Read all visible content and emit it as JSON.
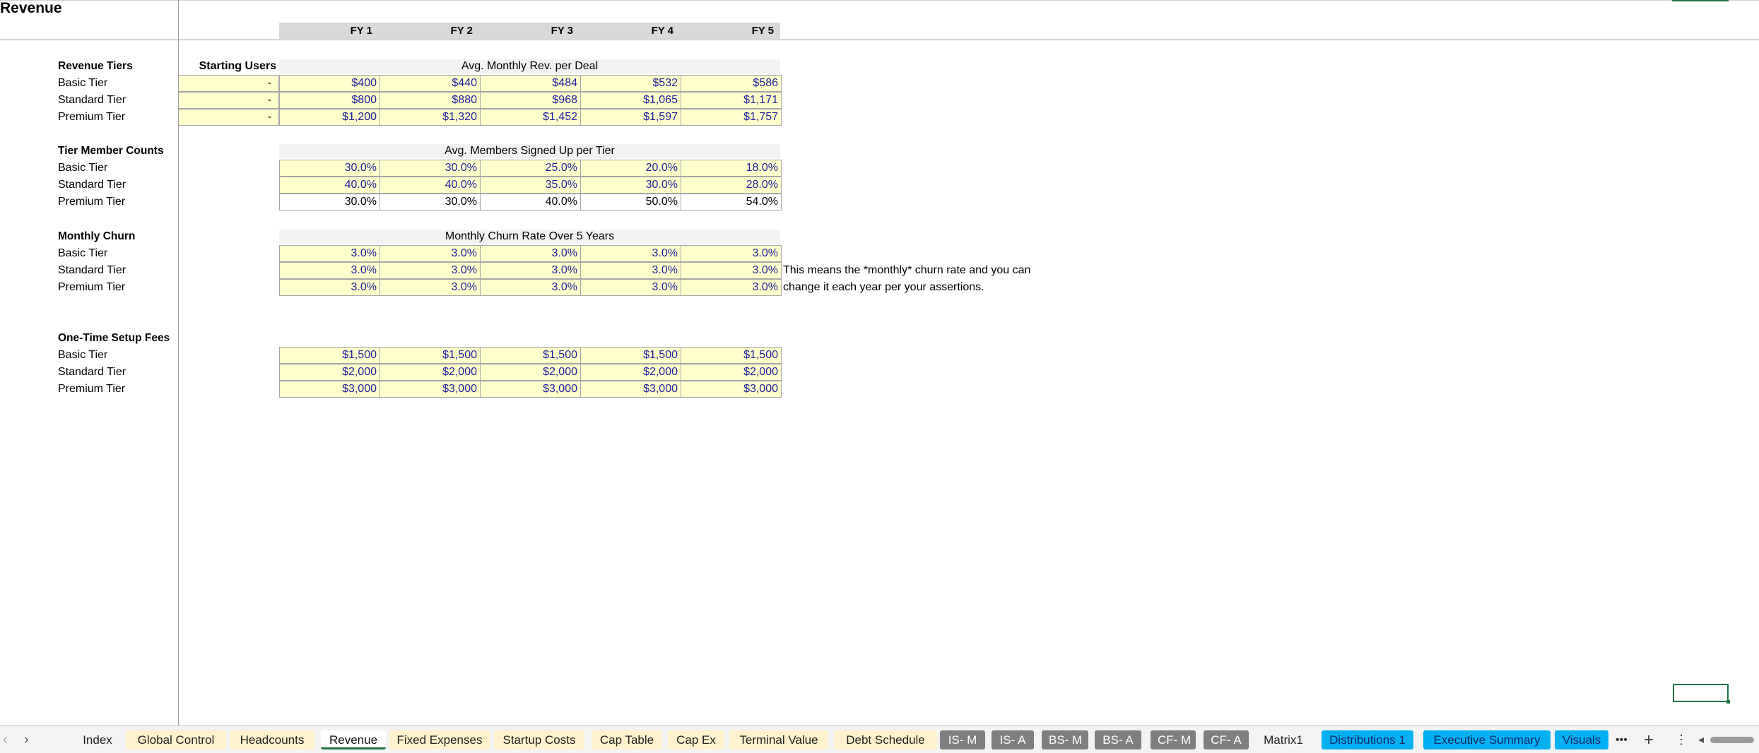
{
  "sheet_title": "Revenue",
  "fiscal_years": [
    "FY 1",
    "FY 2",
    "FY 3",
    "FY 4",
    "FY 5"
  ],
  "revenue_tiers": {
    "label": "Revenue Tiers",
    "starting_users_header": "Starting Users",
    "band_header": "Avg. Monthly Rev. per Deal",
    "rows": [
      {
        "label": "Basic Tier",
        "starting": "-",
        "values": [
          "$400",
          "$440",
          "$484",
          "$532",
          "$586"
        ]
      },
      {
        "label": "Standard Tier",
        "starting": "-",
        "values": [
          "$800",
          "$880",
          "$968",
          "$1,065",
          "$1,171"
        ]
      },
      {
        "label": "Premium Tier",
        "starting": "-",
        "values": [
          "$1,200",
          "$1,320",
          "$1,452",
          "$1,597",
          "$1,757"
        ]
      }
    ]
  },
  "member_counts": {
    "label": "Tier Member Counts",
    "band_header": "Avg. Members Signed Up per Tier",
    "rows": [
      {
        "label": "Basic Tier",
        "values": [
          "30.0%",
          "30.0%",
          "25.0%",
          "20.0%",
          "18.0%"
        ]
      },
      {
        "label": "Standard Tier",
        "values": [
          "40.0%",
          "40.0%",
          "35.0%",
          "30.0%",
          "28.0%"
        ]
      },
      {
        "label": "Premium Tier",
        "values": [
          "30.0%",
          "30.0%",
          "40.0%",
          "50.0%",
          "54.0%"
        ]
      }
    ]
  },
  "monthly_churn": {
    "label": "Monthly Churn",
    "band_header": "Monthly Churn Rate Over 5 Years",
    "rows": [
      {
        "label": "Basic Tier",
        "values": [
          "3.0%",
          "3.0%",
          "3.0%",
          "3.0%",
          "3.0%"
        ]
      },
      {
        "label": "Standard Tier",
        "values": [
          "3.0%",
          "3.0%",
          "3.0%",
          "3.0%",
          "3.0%"
        ]
      },
      {
        "label": "Premium Tier",
        "values": [
          "3.0%",
          "3.0%",
          "3.0%",
          "3.0%",
          "3.0%"
        ]
      }
    ],
    "note_line1": "This means the *monthly* churn rate and you can",
    "note_line2": "change it each year per your assertions."
  },
  "setup_fees": {
    "label": "One-Time Setup Fees",
    "rows": [
      {
        "label": "Basic Tier",
        "values": [
          "$1,500",
          "$1,500",
          "$1,500",
          "$1,500",
          "$1,500"
        ]
      },
      {
        "label": "Standard Tier",
        "values": [
          "$2,000",
          "$2,000",
          "$2,000",
          "$2,000",
          "$2,000"
        ]
      },
      {
        "label": "Premium Tier",
        "values": [
          "$3,000",
          "$3,000",
          "$3,000",
          "$3,000",
          "$3,000"
        ]
      }
    ]
  },
  "tabs": [
    {
      "label": "Index",
      "style": "plain"
    },
    {
      "label": "Global Control",
      "style": "yellow"
    },
    {
      "label": "Headcounts",
      "style": "yellow"
    },
    {
      "label": "Revenue",
      "style": "active"
    },
    {
      "label": "Fixed Expenses",
      "style": "yellow"
    },
    {
      "label": "Startup Costs",
      "style": "yellow"
    },
    {
      "label": "Cap Table",
      "style": "yellow"
    },
    {
      "label": "Cap Ex",
      "style": "yellow"
    },
    {
      "label": "Terminal Value",
      "style": "yellow"
    },
    {
      "label": "Debt Schedule",
      "style": "yellow"
    },
    {
      "label": "IS- M",
      "style": "gray"
    },
    {
      "label": "IS- A",
      "style": "gray"
    },
    {
      "label": "BS- M",
      "style": "gray"
    },
    {
      "label": "BS- A",
      "style": "gray"
    },
    {
      "label": "CF- M",
      "style": "gray"
    },
    {
      "label": "CF- A",
      "style": "gray"
    },
    {
      "label": "Matrix1",
      "style": "plain"
    },
    {
      "label": "Distributions 1",
      "style": "blue"
    },
    {
      "label": "Executive Summary",
      "style": "blue"
    },
    {
      "label": "Visuals",
      "style": "blue"
    }
  ],
  "icons": {
    "prev": "chevron-left-icon",
    "next": "chevron-right-icon",
    "more": "more-tabs-icon",
    "add": "add-sheet-icon",
    "options": "vertical-dots-icon"
  },
  "colors": {
    "input_fill": "#ffffcc",
    "input_text": "#1f1f9e",
    "tab_yellow": "#fff2cc",
    "tab_gray": "#7f7f7f",
    "tab_blue": "#00b0f0",
    "excel_green": "#217346"
  }
}
